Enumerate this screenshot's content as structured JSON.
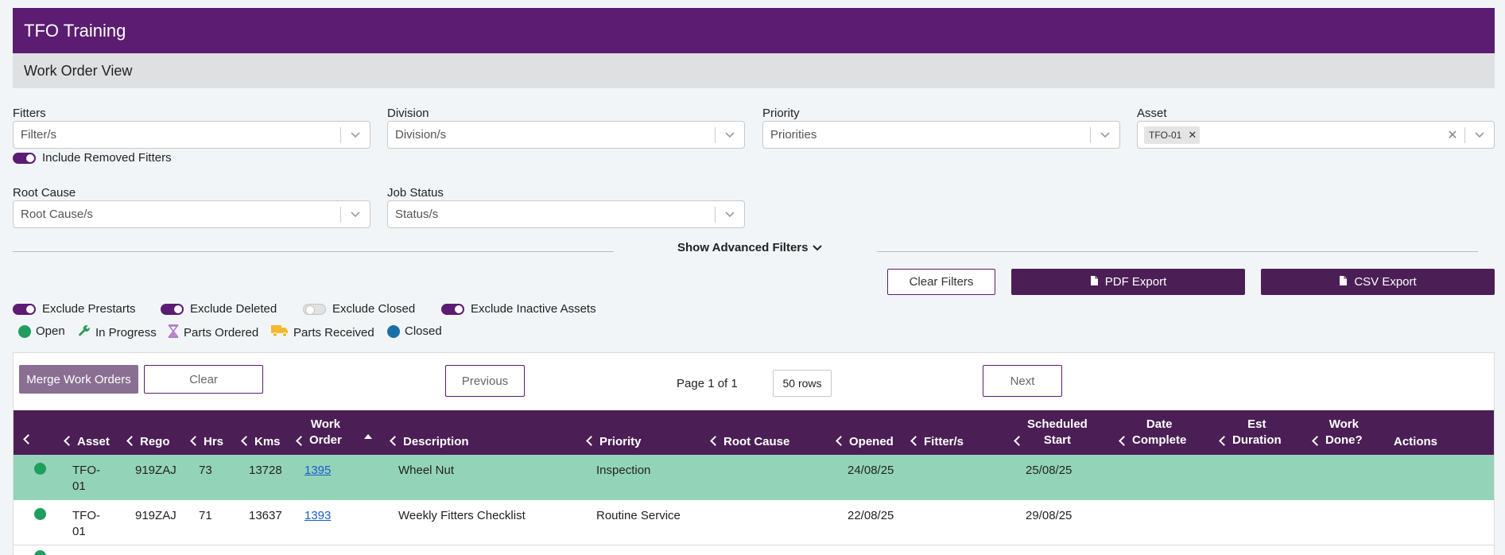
{
  "header": {
    "title": "TFO Training",
    "subtitle": "Work Order View"
  },
  "filters": {
    "fitters": {
      "label": "Fitters",
      "placeholder": "Filter/s"
    },
    "division": {
      "label": "Division",
      "placeholder": "Division/s"
    },
    "priority": {
      "label": "Priority",
      "placeholder": "Priorities"
    },
    "asset": {
      "label": "Asset",
      "chip": "TFO-01"
    },
    "include_removed": "Include Removed Fitters",
    "root_cause": {
      "label": "Root Cause",
      "placeholder": "Root Cause/s"
    },
    "job_status": {
      "label": "Job Status",
      "placeholder": "Status/s"
    },
    "advanced": "Show Advanced Filters"
  },
  "actions": {
    "clear_filters": "Clear Filters",
    "pdf_export": "PDF Export",
    "csv_export": "CSV Export"
  },
  "toggles": [
    {
      "label": "Exclude Prestarts",
      "on": true
    },
    {
      "label": "Exclude Deleted",
      "on": true
    },
    {
      "label": "Exclude Closed",
      "on": false
    },
    {
      "label": "Exclude Inactive Assets",
      "on": true
    }
  ],
  "legend": [
    {
      "label": "Open",
      "icon": "open-dot-icon",
      "color": "#1f9e5e"
    },
    {
      "label": "In Progress",
      "icon": "wrench-icon",
      "color": "#2e9b5a"
    },
    {
      "label": "Parts Ordered",
      "icon": "hourglass-icon",
      "color": "#b07cc6"
    },
    {
      "label": "Parts Received",
      "icon": "truck-icon",
      "color": "#f5b82e"
    },
    {
      "label": "Closed",
      "icon": "closed-dot-icon",
      "color": "#1b6fa8"
    }
  ],
  "pager": {
    "merge": "Merge Work Orders",
    "clear": "Clear",
    "previous": "Previous",
    "page": "Page 1 of 1",
    "rows": "50 rows",
    "next": "Next"
  },
  "table": {
    "columns": {
      "asset": "Asset",
      "rego": "Rego",
      "hrs": "Hrs",
      "kms": "Kms",
      "work_order_1": "Work",
      "work_order_2": "Order",
      "description": "Description",
      "priority": "Priority",
      "root_cause": "Root Cause",
      "opened": "Opened",
      "fitters": "Fitter/s",
      "scheduled_1": "Scheduled",
      "scheduled_2": "Start",
      "date_complete_1": "Date",
      "date_complete_2": "Complete",
      "est_duration_1": "Est",
      "est_duration_2": "Duration",
      "work_done_1": "Work",
      "work_done_2": "Done?",
      "actions": "Actions"
    },
    "rows": [
      {
        "asset_1": "TFO-",
        "asset_2": "01",
        "rego": "919ZAJ",
        "hrs": "73",
        "kms": "13728",
        "work_order": "1395",
        "description": "Wheel Nut",
        "priority": "Inspection",
        "opened": "24/08/25",
        "scheduled": "25/08/25"
      },
      {
        "asset_1": "TFO-",
        "asset_2": "01",
        "rego": "919ZAJ",
        "hrs": "71",
        "kms": "13637",
        "work_order": "1393",
        "description": "Weekly Fitters Checklist",
        "priority": "Routine Service",
        "opened": "22/08/25",
        "scheduled": "29/08/25"
      }
    ]
  },
  "colors": {
    "brand": "#5b1c72",
    "header_dark": "#4b1f55",
    "row_highlight": "#93d4b8"
  }
}
